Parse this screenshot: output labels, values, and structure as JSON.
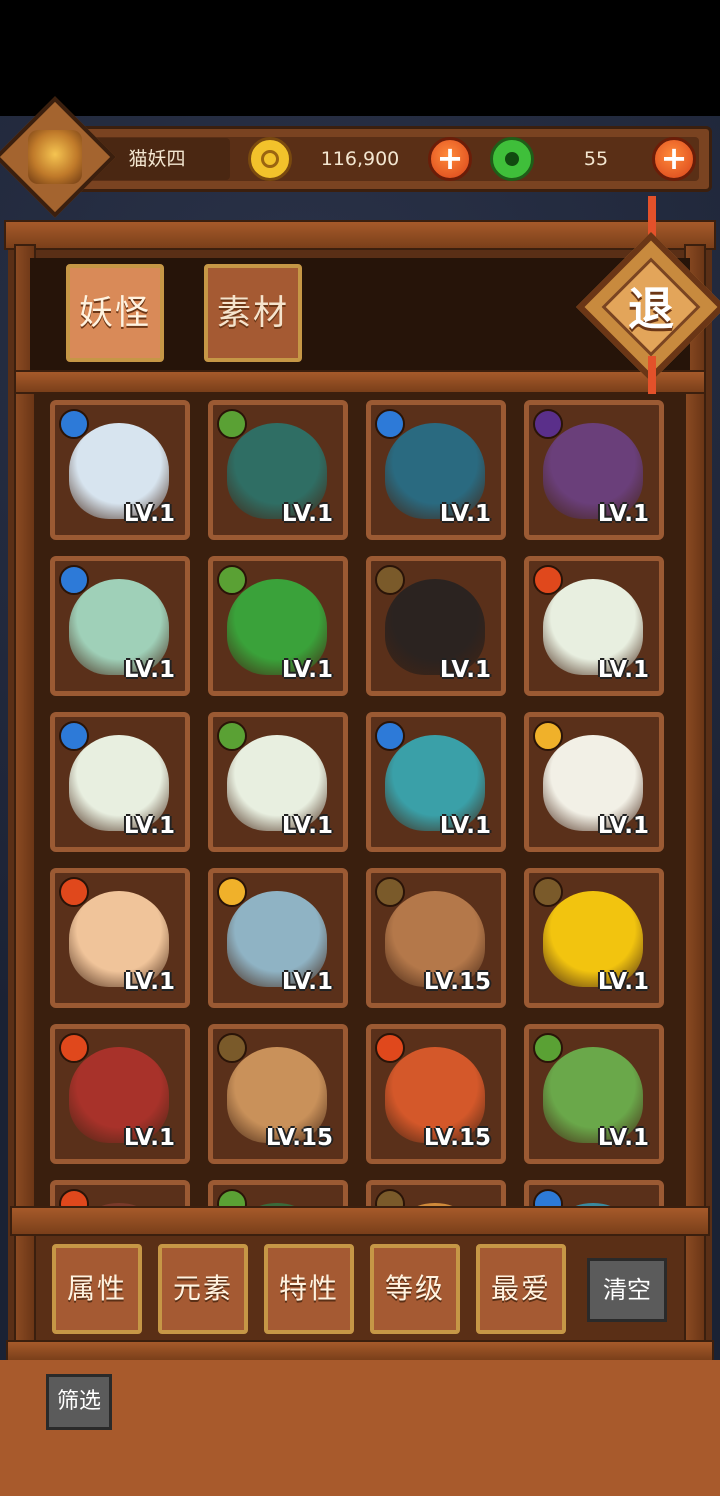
{
  "header": {
    "player_name": "猫妖四",
    "coins": "116,900",
    "jade": "55",
    "plus_symbol": "+"
  },
  "tabs": [
    {
      "label": "妖怪",
      "active": true
    },
    {
      "label": "素材",
      "active": false
    }
  ],
  "exit_label": "退",
  "monsters": [
    {
      "element": "water",
      "level": "LV.1",
      "palette": "#d7e4ef"
    },
    {
      "element": "wood",
      "level": "LV.1",
      "palette": "#2f6e64"
    },
    {
      "element": "water",
      "level": "LV.1",
      "palette": "#2a6a80"
    },
    {
      "element": "dark",
      "level": "LV.1",
      "palette": "#6a3f7a"
    },
    {
      "element": "water",
      "level": "LV.1",
      "palette": "#9fd0b8"
    },
    {
      "element": "wood",
      "level": "LV.1",
      "palette": "#3aa23a"
    },
    {
      "element": "earth",
      "level": "LV.1",
      "palette": "#2b2320"
    },
    {
      "element": "fire",
      "level": "LV.1",
      "palette": "#e8efe0"
    },
    {
      "element": "water",
      "level": "LV.1",
      "palette": "#e8efe0"
    },
    {
      "element": "wood",
      "level": "LV.1",
      "palette": "#e8efe0"
    },
    {
      "element": "water",
      "level": "LV.1",
      "palette": "#3aa0a8"
    },
    {
      "element": "light",
      "level": "LV.1",
      "palette": "#f2f0e6"
    },
    {
      "element": "fire",
      "level": "LV.1",
      "palette": "#f0c49a"
    },
    {
      "element": "light",
      "level": "LV.1",
      "palette": "#8fb3c4"
    },
    {
      "element": "earth",
      "level": "LV.15",
      "palette": "#b4784a"
    },
    {
      "element": "earth",
      "level": "LV.1",
      "palette": "#f2c40f"
    },
    {
      "element": "fire",
      "level": "LV.1",
      "palette": "#a8322a"
    },
    {
      "element": "earth",
      "level": "LV.15",
      "palette": "#c9915a"
    },
    {
      "element": "fire",
      "level": "LV.15",
      "palette": "#d4582a"
    },
    {
      "element": "wood",
      "level": "LV.1",
      "palette": "#6aa84a"
    },
    {
      "element": "fire",
      "level": "",
      "palette": "#7a3a2a"
    },
    {
      "element": "wood",
      "level": "",
      "palette": "#3a6a3a"
    },
    {
      "element": "earth",
      "level": "",
      "palette": "#d08a3a"
    },
    {
      "element": "water",
      "level": "",
      "palette": "#3a8aa0"
    }
  ],
  "filters": [
    "属性",
    "元素",
    "特性",
    "等级",
    "最爱"
  ],
  "clear_label": "清空",
  "screen_label": "筛选"
}
